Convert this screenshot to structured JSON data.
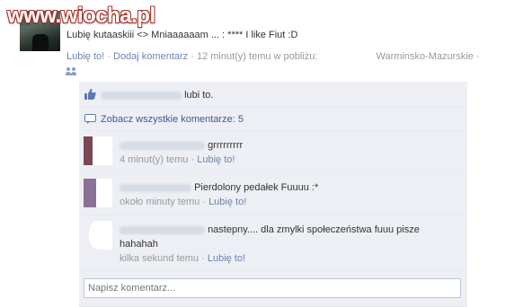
{
  "watermark": {
    "text": "www.wiocha.pl"
  },
  "post": {
    "status_text": "Lubię kutaaskiii <> Mniaaaaaam ... : **** I like Fiut :D",
    "like_link": "Lubię to!",
    "comment_link": "Dodaj komentarz",
    "time_text": "12 minut(y) temu w pobliżu:",
    "place": "Warminsko-Mazurskie",
    "separator": "·",
    "audience_icon": "people-icon"
  },
  "ufi": {
    "likes": {
      "icon": "thumbs-up-icon",
      "text": "lubi to."
    },
    "view_all": {
      "icon": "comment-bubble-icon",
      "text": "Zobacz wszystkie komentarze: 5"
    },
    "comments": [
      {
        "text": "grrrrrrrrr",
        "time": "4 minut(y) temu",
        "like": "Lubię to!"
      },
      {
        "text": "Pierdolony pedałek Fuuuu :*",
        "time": "około minuty temu",
        "like": "Lubię to!"
      },
      {
        "text": "nastepny.... dla zmylki społeczeństwa fuuu pisze hahahah",
        "time": "kilka sekund temu",
        "like": "Lubię to!"
      }
    ],
    "composer": {
      "placeholder": "Napisz komentarz..."
    }
  },
  "colors": {
    "link": "#3b5998",
    "muted_link": "#6d84b4",
    "ufi_background": "#edeff4",
    "watermark_outline": "#a7352b"
  }
}
